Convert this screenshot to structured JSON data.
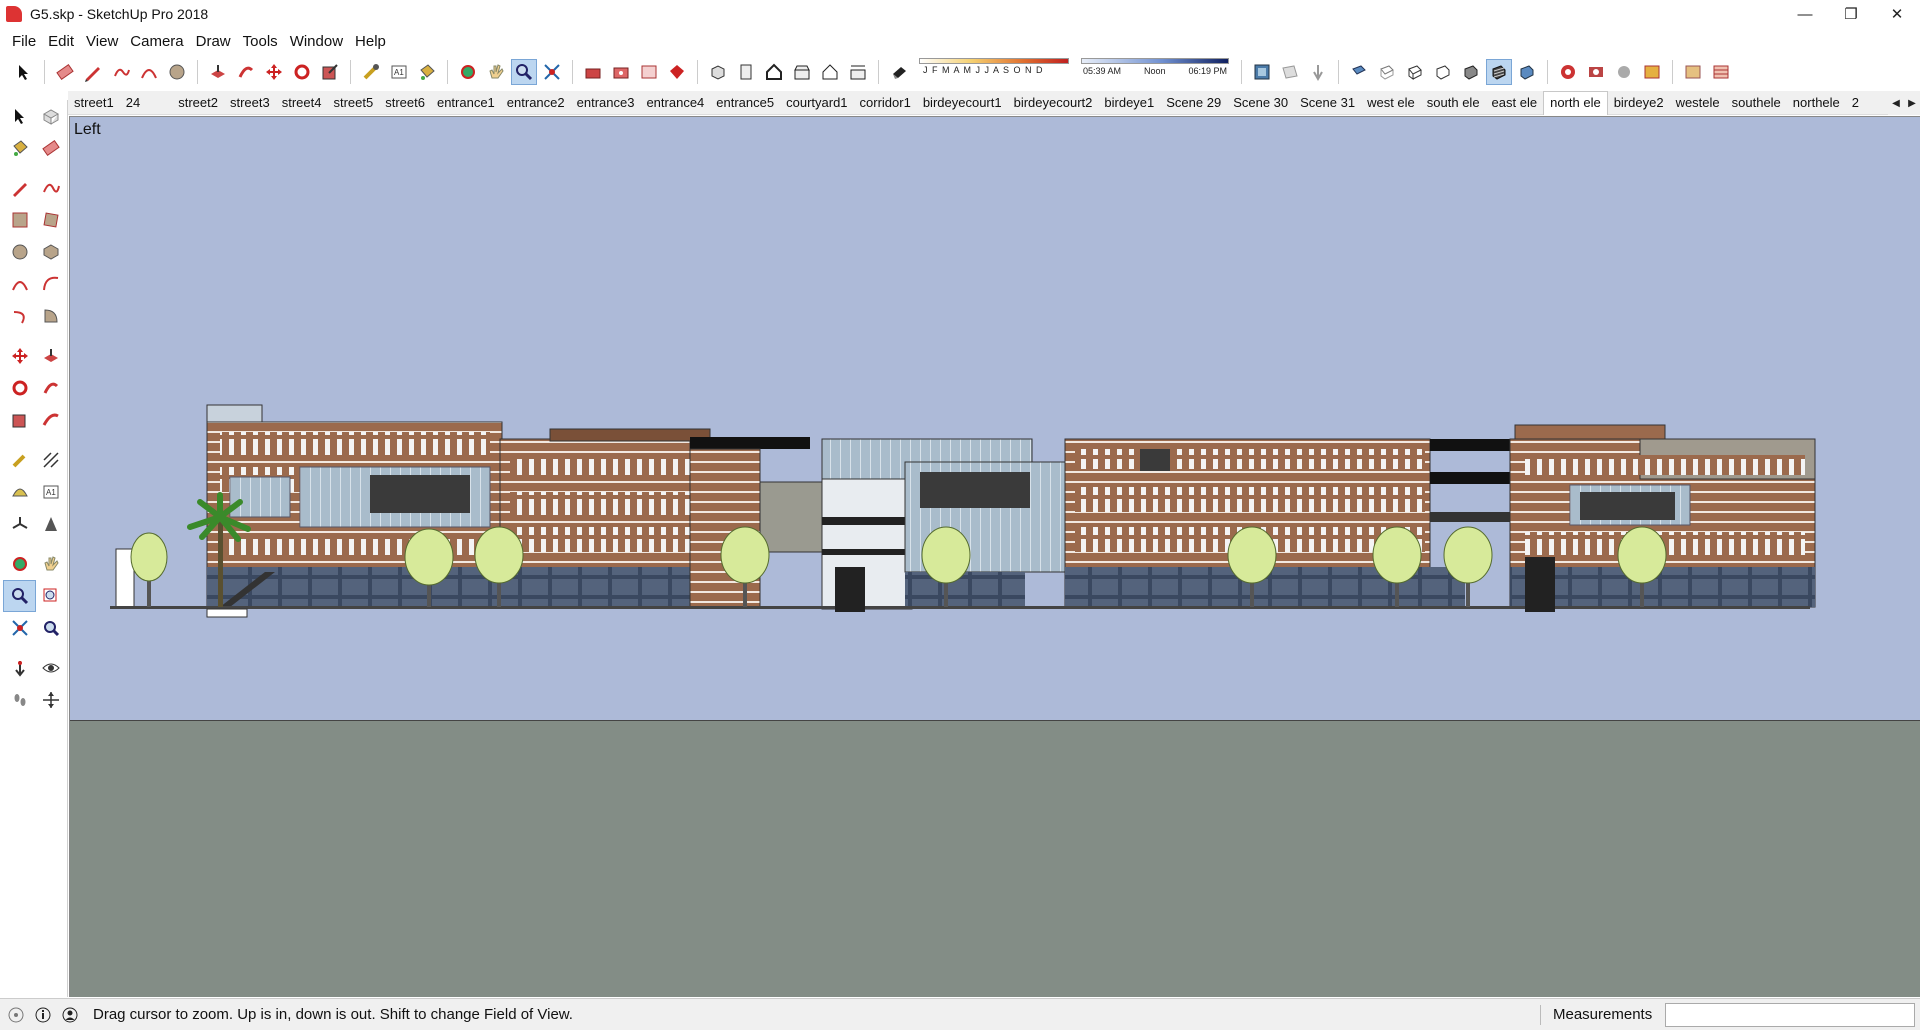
{
  "window": {
    "title": "G5.skp - SketchUp Pro 2018",
    "minimize": "—",
    "maximize": "❐",
    "close": "✕"
  },
  "menu": [
    "File",
    "Edit",
    "View",
    "Camera",
    "Draw",
    "Tools",
    "Window",
    "Help"
  ],
  "shadow_months": "J F M A M J J A S O N D",
  "shadow_times": {
    "start": "05:39 AM",
    "noon": "Noon",
    "end": "06:19 PM"
  },
  "scene_tabs": [
    "street1",
    "24",
    "street2",
    "street3",
    "street4",
    "street5",
    "street6",
    "entrance1",
    "entrance2",
    "entrance3",
    "entrance4",
    "entrance5",
    "courtyard1",
    "corridor1",
    "birdeyecourt1",
    "birdeyecourt2",
    "birdeye1",
    "Scene 29",
    "Scene 30",
    "Scene 31",
    "west ele",
    "south ele",
    "east ele",
    "north ele",
    "birdeye2",
    "westele",
    "southele",
    "northele",
    "2"
  ],
  "active_scene": "north ele",
  "viewport": {
    "view_name": "Left"
  },
  "status": {
    "hint": "Drag cursor to zoom.  Up is in, down is out. Shift to change Field of View.",
    "measurements_label": "Measurements",
    "measurements_value": ""
  },
  "colors": {
    "sky": "#adbad8",
    "ground": "#838d86",
    "facade": "#9b6a4d",
    "glass": "#a9bccb",
    "tree": "#d7ea9a"
  }
}
